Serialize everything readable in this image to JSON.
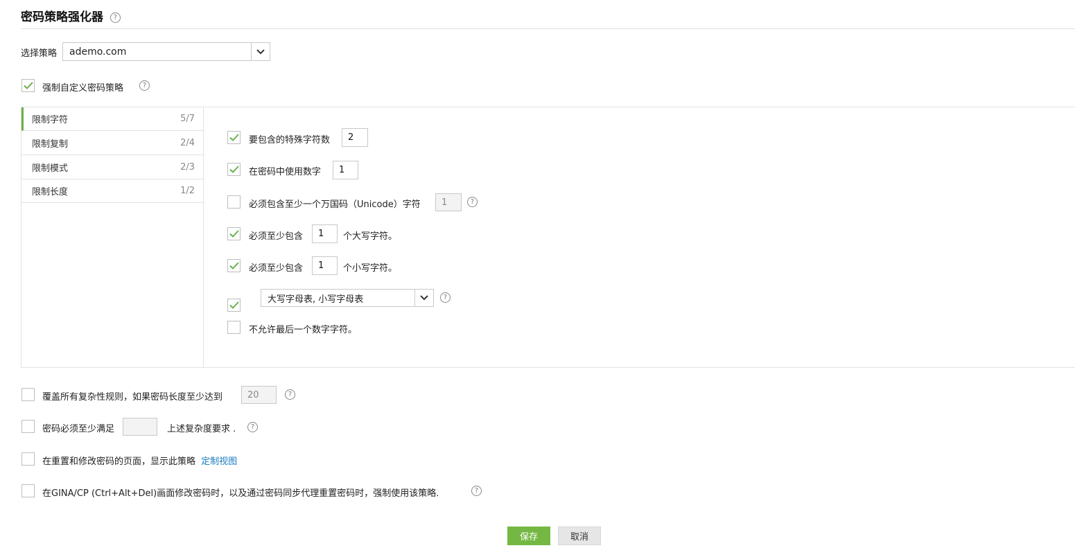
{
  "page": {
    "title": "密码策略强化器"
  },
  "policy_select": {
    "label": "选择策略",
    "value": "ademo.com"
  },
  "enforce_custom": {
    "checked": true,
    "label": "强制自定义密码策略"
  },
  "tabs": [
    {
      "name": "限制字符",
      "count": "5/7",
      "active": true
    },
    {
      "name": "限制复制",
      "count": "2/4",
      "active": false
    },
    {
      "name": "限制模式",
      "count": "2/3",
      "active": false
    },
    {
      "name": "限制长度",
      "count": "1/2",
      "active": false
    }
  ],
  "rules": {
    "special_chars": {
      "checked": true,
      "label": "要包含的特殊字符数",
      "value": "2"
    },
    "use_digits": {
      "checked": true,
      "label": "在密码中使用数字",
      "value": "1"
    },
    "unicode": {
      "checked": false,
      "label": "必须包含至少一个万国码（Unicode）字符",
      "value": "1"
    },
    "uppercase": {
      "checked": true,
      "label_before": "必须至少包含",
      "value": "1",
      "label_after": "个大写字符。"
    },
    "lowercase": {
      "checked": true,
      "label_before": "必须至少包含",
      "value": "1",
      "label_after": "个小写字符。"
    },
    "alphabet_select": {
      "checked": true,
      "value": "大写字母表, 小写字母表"
    },
    "no_last_digit": {
      "checked": false,
      "label": "不允许最后一个数字字符。"
    }
  },
  "override": {
    "checked": false,
    "label": "覆盖所有复杂性规则，如果密码长度至少达到",
    "value": "20"
  },
  "must_satisfy": {
    "checked": false,
    "label_before": "密码必须至少满足",
    "value": "",
    "label_after": "上述复杂度要求 ."
  },
  "show_on_pages": {
    "checked": false,
    "label": "在重置和修改密码的页面，显示此策略",
    "link": "定制视图"
  },
  "gina": {
    "checked": false,
    "label": "在GINA/CP (Ctrl+Alt+Del)画面修改密码时，以及通过密码同步代理重置密码时，强制使用该策略."
  },
  "buttons": {
    "save": "保存",
    "cancel": "取消"
  },
  "colors": {
    "accent_green": "#74b843",
    "check_green": "#6ab04c",
    "link_blue": "#1a7bbf"
  }
}
